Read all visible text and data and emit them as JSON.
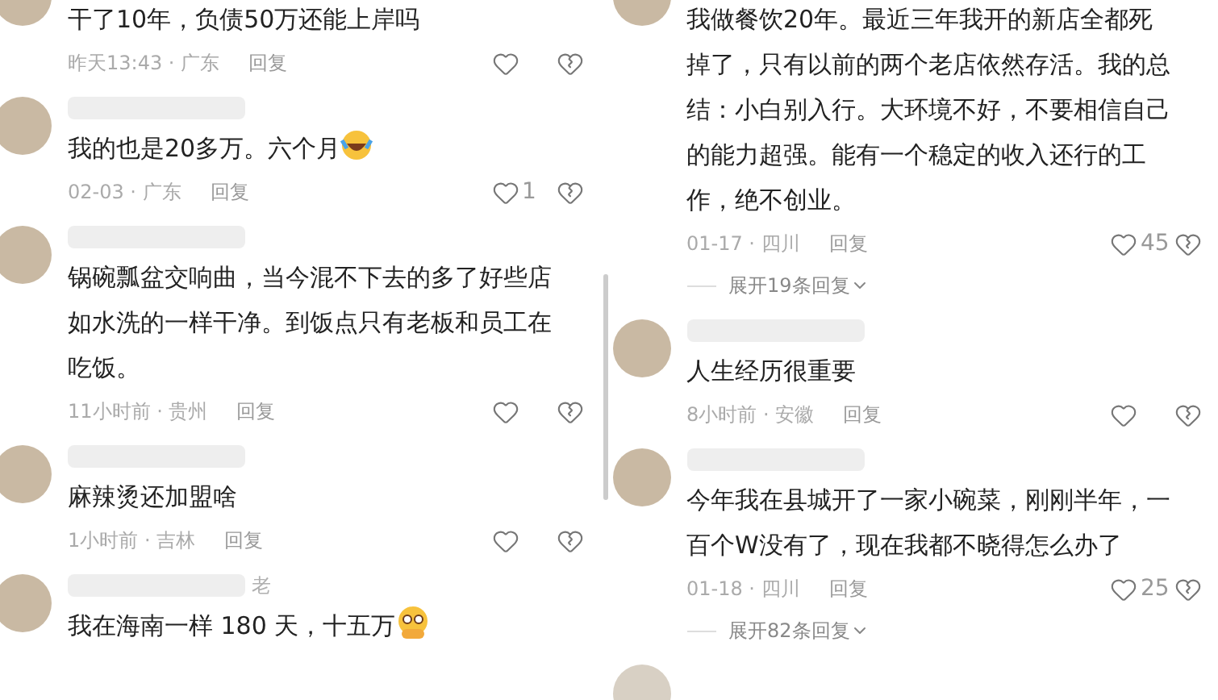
{
  "columns": [
    {
      "comments": [
        {
          "kind": "plain",
          "text": "干了10年，负债50万还能上岸吗",
          "time": "昨天13:43 · 广东",
          "reply": "回复"
        },
        {
          "kind": "laugh-cry",
          "text": "我的也是20多万。六个月",
          "time": "02-03 · 广东",
          "reply": "回复",
          "likes": "1"
        },
        {
          "kind": "plain",
          "text": "锅碗瓢盆交响曲，当今混不下去的多了好些店如水洗的一样干净。到饭点只有老板和员工在吃饭。",
          "time": "11小时前 · 贵州",
          "reply": "回复"
        },
        {
          "kind": "plain",
          "text": "麻辣烫还加盟啥",
          "time": "1小时前 · 吉林",
          "reply": "回复"
        },
        {
          "kind": "teary",
          "name": "老",
          "text": "我在海南一样 180 天，十五万"
        }
      ]
    },
    {
      "comments": [
        {
          "kind": "plain",
          "text": "我做餐饮20年。最近三年我开的新店全都死掉了，只有以前的两个老店依然存活。我的总结：小白别入行。大环境不好，不要相信自己的能力超强。能有一个稳定的收入还行的工作，绝不创业。",
          "time": "01-17 · 四川",
          "reply": "回复",
          "likes": "45",
          "expand": "展开19条回复"
        },
        {
          "kind": "plain",
          "text": "人生经历很重要",
          "time": "8小时前 · 安徽",
          "reply": "回复"
        },
        {
          "kind": "plain",
          "text": "今年我在县城开了一家小碗菜，刚刚半年，一百个W没有了，现在我都不晓得怎么办了",
          "time": "01-18 · 四川",
          "reply": "回复",
          "likes": "25",
          "expand": "展开82条回复"
        }
      ]
    }
  ]
}
